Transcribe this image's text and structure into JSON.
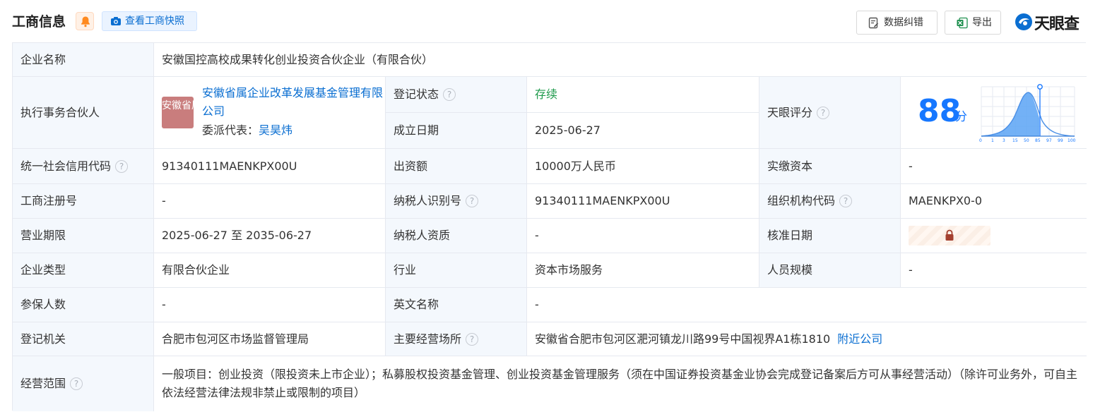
{
  "header": {
    "title": "工商信息",
    "snapshot_button": "查看工商快照",
    "correct_button": "数据纠错",
    "export_button": "导出",
    "brand": "天眼查"
  },
  "rows": {
    "company_name": {
      "label": "企业名称",
      "value": "安徽国控高校成果转化创业投资合伙企业（有限合伙）"
    },
    "partner": {
      "label": "执行事务合伙人",
      "badge": "安徽省属",
      "name": "安徽省属企业改革发展基金管理有限公司",
      "rep_label": "委派代表：",
      "rep_name": "吴昊炜"
    },
    "reg_status": {
      "label": "登记状态",
      "value": "存续"
    },
    "founded": {
      "label": "成立日期",
      "value": "2025-06-27"
    },
    "score": {
      "label": "天眼评分",
      "value": "88",
      "unit": "分",
      "axis": [
        "0",
        "1",
        "3",
        "15",
        "50",
        "85",
        "97",
        "99",
        "100"
      ]
    },
    "credit_code": {
      "label": "统一社会信用代码",
      "value": "91340111MAENKPX00U"
    },
    "capital": {
      "label": "出资额",
      "value": "10000万人民币"
    },
    "paid_capital": {
      "label": "实缴资本",
      "value": "-"
    },
    "reg_no": {
      "label": "工商注册号",
      "value": "-"
    },
    "taxpayer_id": {
      "label": "纳税人识别号",
      "value": "91340111MAENKPX00U"
    },
    "org_code": {
      "label": "组织机构代码",
      "value": "MAENKPX0-0"
    },
    "term": {
      "label": "营业期限",
      "value": "2025-06-27 至 2035-06-27"
    },
    "taxpayer_qual": {
      "label": "纳税人资质",
      "value": "-"
    },
    "approve_date": {
      "label": "核准日期"
    },
    "company_type": {
      "label": "企业类型",
      "value": "有限合伙企业"
    },
    "industry": {
      "label": "行业",
      "value": "资本市场服务"
    },
    "staff_size": {
      "label": "人员规模",
      "value": "-"
    },
    "insured": {
      "label": "参保人数",
      "value": "-"
    },
    "english_name": {
      "label": "英文名称",
      "value": "-"
    },
    "reg_authority": {
      "label": "登记机关",
      "value": "合肥市包河区市场监督管理局"
    },
    "address": {
      "label": "主要经营场所",
      "value": "安徽省合肥市包河区淝河镇龙川路99号中国视界A1栋1810",
      "link": "附近公司"
    },
    "scope": {
      "label": "经营范围",
      "value": "一般项目：创业投资（限投资未上市企业）；私募股权投资基金管理、创业投资基金管理服务（须在中国证券投资基金业协会完成登记备案后方可从事经营活动）（除许可业务外，可自主依法经营法律法规非禁止或限制的项目）"
    }
  },
  "colors": {
    "accent": "#0a6ed1",
    "label_bg": "#f4f8fd",
    "status_green": "#1e9a4b",
    "score_blue": "#1677ff"
  }
}
